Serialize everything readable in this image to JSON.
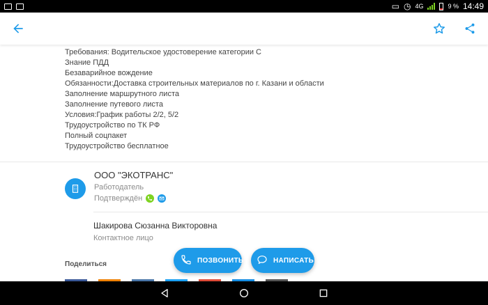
{
  "status_bar": {
    "network": "4G",
    "battery": "9 %",
    "time": "14:49"
  },
  "app_bar": {
    "back_icon": "arrow-left-icon",
    "favorite_icon": "star-outline-icon",
    "share_icon": "share-icon"
  },
  "description": {
    "lines": [
      "Требования: Водительское удостоверение категории С",
      "Знание ПДД",
      "Безаварийное вождение",
      "Обязанности:Доставка строительных материалов по г. Казани и области",
      "Заполнение маршрутного листа",
      "Заполнение путевого листа",
      "Условия:График работы 2/2, 5/2",
      "Трудоустройство по ТК РФ",
      "Полный соцпакет",
      "Трудоустройство бесплатное"
    ]
  },
  "employer": {
    "name": "ООО \"ЭКОТРАНС\"",
    "type": "Работодатель",
    "verified": "Подтверждён",
    "colors": {
      "accent": "#1e9be9",
      "phone_badge": "#7ed321"
    }
  },
  "contact": {
    "name": "Шакирова Сюзанна Викторовна",
    "role": "Контактное лицо"
  },
  "share": {
    "label": "Поделиться"
  },
  "actions": {
    "call_label": "ПОЗВОНИТЬ",
    "write_label": "НАПИСАТЬ"
  }
}
